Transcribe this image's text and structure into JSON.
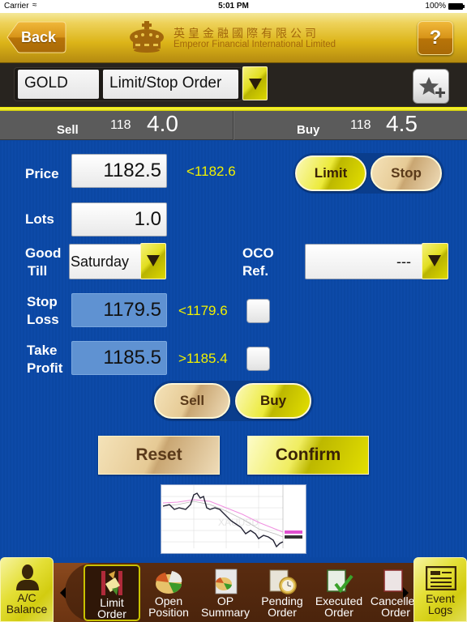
{
  "status_bar": {
    "carrier": "Carrier",
    "time": "5:01 PM",
    "battery": "100%"
  },
  "header": {
    "back_label": "Back",
    "company_name_cn": "英皇金融國際有限公司",
    "company_name_en": "Emperor Financial International Limited",
    "help_label": "?"
  },
  "selector": {
    "symbol": "GOLD",
    "order_type": "Limit/Stop Order"
  },
  "quote": {
    "sell_label": "Sell",
    "sell_prefix": "118",
    "sell_main": "4.0",
    "buy_label": "Buy",
    "buy_prefix": "118",
    "buy_main": "4.5"
  },
  "form": {
    "price_label": "Price",
    "price_value": "1182.5",
    "price_hint": "<1182.6",
    "limit_label": "Limit",
    "stop_label": "Stop",
    "price_mode_selected": "Limit",
    "lots_label": "Lots",
    "lots_value": "1.0",
    "good_till_label_1": "Good",
    "good_till_label_2": "Till",
    "good_till_value": "Saturday",
    "oco_label_1": "OCO",
    "oco_label_2": "Ref.",
    "oco_value": "---",
    "stop_loss_label_1": "Stop",
    "stop_loss_label_2": "Loss",
    "stop_loss_value": "1179.5",
    "stop_loss_hint": "<1179.6",
    "stop_loss_checked": false,
    "take_profit_label_1": "Take",
    "take_profit_label_2": "Profit",
    "take_profit_value": "1185.5",
    "take_profit_hint": ">1185.4",
    "take_profit_checked": false,
    "sell_label": "Sell",
    "buy_label": "Buy",
    "side_selected": "Buy",
    "reset_label": "Reset",
    "confirm_label": "Confirm",
    "chart_watermark": "XAUUSD"
  },
  "toolbar": {
    "left_button": "A/C Balance",
    "left_button_line1": "A/C",
    "left_button_line2": "Balance",
    "right_button_line1": "Event",
    "right_button_line2": "Logs",
    "items": [
      {
        "line1": "Limit",
        "line2": "Order",
        "icon": "limit-order-icon",
        "active": true
      },
      {
        "line1": "Open",
        "line2": "Position",
        "icon": "pie-chart-icon",
        "active": false
      },
      {
        "line1": "OP",
        "line2": "Summary",
        "icon": "summary-report-icon",
        "active": false
      },
      {
        "line1": "Pending",
        "line2": "Order",
        "icon": "clock-document-icon",
        "active": false
      },
      {
        "line1": "Executed",
        "line2": "Order",
        "icon": "checkmark-document-icon",
        "active": false
      },
      {
        "line1": "Cancelled",
        "line2": "Order",
        "icon": "cancelled-document-icon",
        "active": false
      }
    ]
  },
  "colors": {
    "form_background": "#0b47a3",
    "hint_yellow": "#f0f000",
    "header_gold": "#dcb418",
    "toolbar_brown": "#7a3d16"
  }
}
